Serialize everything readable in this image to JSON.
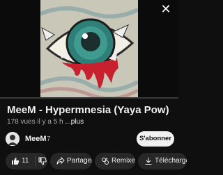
{
  "player": {
    "progress_fraction": 0
  },
  "video": {
    "title": "MeeM - Hypermnesia (Yaya Pow)",
    "views": "178 vues",
    "age": "il y a 5 h",
    "more_label": "...plus"
  },
  "channel": {
    "name": "MeeM",
    "subscribers": "7",
    "subscribe_label": "S'abonner"
  },
  "actions": {
    "like_count": "11",
    "share_label": "Partager",
    "remix_label": "Remixer",
    "download_label": "Télécharger"
  },
  "colors": {
    "background": "#0f0f0f",
    "pill": "#272727",
    "subscribe_bg": "#f1f1f1",
    "secondary_text": "#aaaaaa"
  },
  "icons": [
    "close-icon",
    "thumbs-up-icon",
    "thumbs-down-icon",
    "share-icon",
    "remix-icon",
    "download-icon"
  ]
}
